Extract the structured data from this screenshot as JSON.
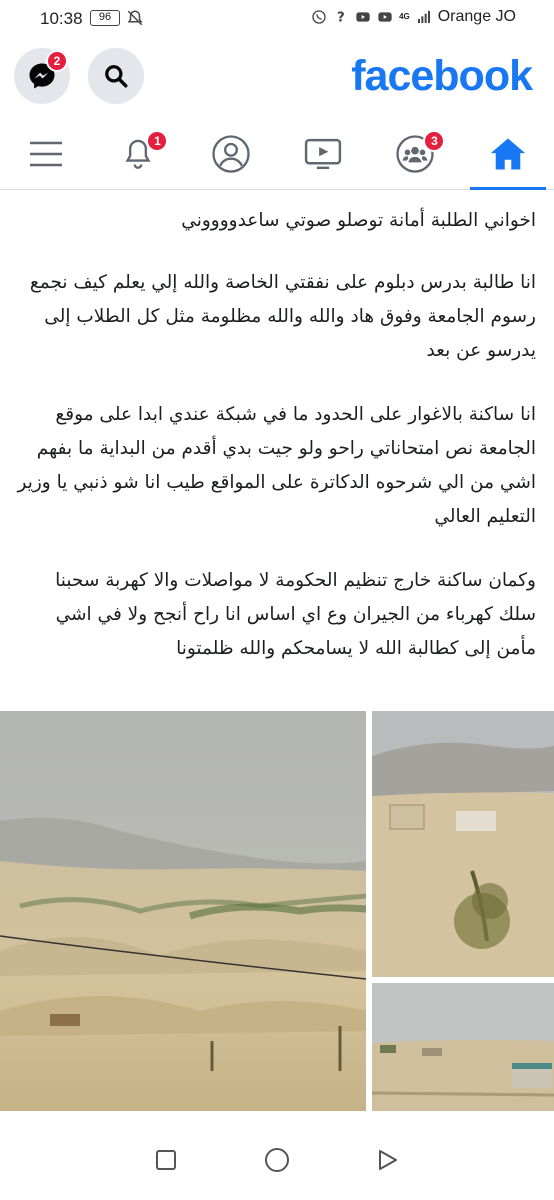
{
  "status_bar": {
    "time": "10:38",
    "battery": "96",
    "carrier": "Orange JO",
    "network": "4G",
    "icons": [
      "mute-icon",
      "whatsapp-icon",
      "question-icon",
      "youtube-icon",
      "youtube-icon",
      "signal-icon"
    ]
  },
  "header": {
    "logo": "facebook",
    "messenger_badge": "2",
    "brand_color": "#1877f2"
  },
  "nav": {
    "tabs": [
      {
        "name": "menu",
        "icon": "menu-icon"
      },
      {
        "name": "notifications",
        "icon": "bell-icon",
        "badge": "1"
      },
      {
        "name": "profile",
        "icon": "profile-icon"
      },
      {
        "name": "watch",
        "icon": "video-icon"
      },
      {
        "name": "groups",
        "icon": "groups-icon",
        "badge": "3"
      },
      {
        "name": "home",
        "icon": "home-icon",
        "active": true
      }
    ]
  },
  "post": {
    "paragraphs": [
      "اخواني الطلبة أمانة توصلو صوتي ساعدووووني",
      "انا طالبة بدرس دبلوم على نفقتي الخاصة والله إلي يعلم كيف نجمع رسوم الجامعة وفوق هاد والله والله مظلومة مثل كل الطلاب إلى يدرسو عن بعد",
      "انا ساكنة بالاغوار على الحدود ما في شبكة عندي ابدا على موقع الجامعة نص امتحاناتي راحو ولو جيت بدي أقدم من البداية ما بفهم اشي من الي شرحوه الدكاترة على المواقع طيب انا شو ذنبي يا وزير التعليم العالي",
      "وكمان ساكنة خارج تنظيم الحكومة لا مواصلات والا كهربة سحبنا سلك كهرباء من الجيران وع اي اساس انا راح أنجح ولا في اشي مأمن إلى كطالبة الله لا يسامحكم والله ظلمتونا"
    ],
    "photos": [
      "desert-landscape-photo",
      "building-photo",
      "village-photo"
    ]
  },
  "system_nav": {
    "buttons": [
      "recents-button",
      "home-button",
      "back-button"
    ]
  }
}
